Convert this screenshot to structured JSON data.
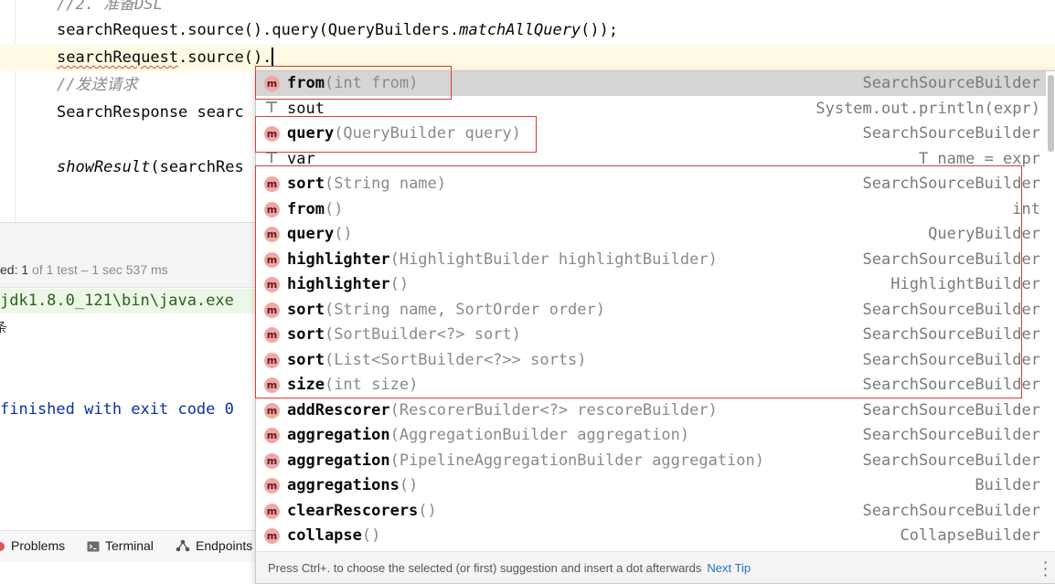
{
  "editor": {
    "lines": [
      "//2. 准备DSL",
      "searchRequest.source().query(QueryBuilders.",
      "matchAllQuery",
      "());",
      "searchRequest",
      ".source().",
      "//发送请求",
      "SearchResponse searc",
      "showResult",
      "(searchRes"
    ]
  },
  "run_panel": {
    "status_prefix": "ed: 1",
    "status_suffix": " of 1 test – 1 sec 537 ms",
    "command": "jdk1.8.0_121\\bin\\java.exe",
    "glyph": "条",
    "finished": "finished with exit code 0"
  },
  "tool_tabs": [
    {
      "label": "Problems",
      "icon": "error-circle-icon"
    },
    {
      "label": "Terminal",
      "icon": "terminal-icon"
    },
    {
      "label": "Endpoints",
      "icon": "endpoints-icon"
    }
  ],
  "popup": {
    "items": [
      {
        "kind": "m",
        "name": "from",
        "sig": "(int from)",
        "type": "SearchSourceBuilder",
        "selected": true
      },
      {
        "kind": "t",
        "name": "sout",
        "sig": "",
        "type": "System.out.println(expr)"
      },
      {
        "kind": "m",
        "name": "query",
        "sig": "(QueryBuilder query)",
        "type": "SearchSourceBuilder"
      },
      {
        "kind": "t",
        "name": "var",
        "sig": "",
        "type": "T name = expr"
      },
      {
        "kind": "m",
        "name": "sort",
        "sig": "(String name)",
        "type": "SearchSourceBuilder"
      },
      {
        "kind": "m",
        "name": "from",
        "sig": "()",
        "type": "int"
      },
      {
        "kind": "m",
        "name": "query",
        "sig": "()",
        "type": "QueryBuilder"
      },
      {
        "kind": "m",
        "name": "highlighter",
        "sig": "(HighlightBuilder highlightBuilder)",
        "type": "SearchSourceBuilder"
      },
      {
        "kind": "m",
        "name": "highlighter",
        "sig": "()",
        "type": "HighlightBuilder"
      },
      {
        "kind": "m",
        "name": "sort",
        "sig": "(String name, SortOrder order)",
        "type": "SearchSourceBuilder"
      },
      {
        "kind": "m",
        "name": "sort",
        "sig": "(SortBuilder<?> sort)",
        "type": "SearchSourceBuilder"
      },
      {
        "kind": "m",
        "name": "sort",
        "sig": "(List<SortBuilder<?>> sorts)",
        "type": "SearchSourceBuilder"
      },
      {
        "kind": "m",
        "name": "size",
        "sig": "(int size)",
        "type": "SearchSourceBuilder"
      },
      {
        "kind": "m",
        "name": "addRescorer",
        "sig": "(RescorerBuilder<?> rescoreBuilder)",
        "type": "SearchSourceBuilder"
      },
      {
        "kind": "m",
        "name": "aggregation",
        "sig": "(AggregationBuilder aggregation)",
        "type": "SearchSourceBuilder"
      },
      {
        "kind": "m",
        "name": "aggregation",
        "sig": "(PipelineAggregationBuilder aggregation)",
        "type": "SearchSourceBuilder"
      },
      {
        "kind": "m",
        "name": "aggregations",
        "sig": "()",
        "type": "Builder"
      },
      {
        "kind": "m",
        "name": "clearRescorers",
        "sig": "()",
        "type": "SearchSourceBuilder"
      },
      {
        "kind": "m",
        "name": "collapse",
        "sig": "()",
        "type": "CollapseBuilder"
      }
    ],
    "m_icon_letter": "m",
    "footer_text": "Press Ctrl+. to choose the selected (or first) suggestion and insert a dot afterwards",
    "footer_link": "Next Tip"
  },
  "colors": {
    "annotation": "#d93a3a",
    "method_icon": "#f2a7a7",
    "selected_row": "#d5d5d5",
    "link": "#2470c4"
  }
}
